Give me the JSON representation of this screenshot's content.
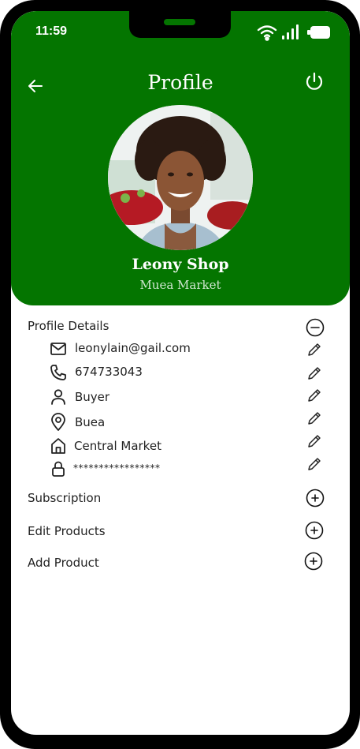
{
  "status_bar": {
    "time": "11:59"
  },
  "header": {
    "title": "Profile",
    "shop_name": "Leony Shop",
    "shop_location": "Muea Market"
  },
  "sections": {
    "profile_details": "Profile Details",
    "subscription": "Subscription",
    "edit_products": "Edit Products",
    "add_product": "Add Product"
  },
  "details": {
    "email": "leonylain@gail.com",
    "phone": "674733043",
    "role": "Buyer",
    "city": "Buea",
    "address": "Central Market",
    "password": "*****************"
  },
  "colors": {
    "brand_green": "#047500",
    "text": "#222222"
  },
  "icons": [
    "back-arrow-icon",
    "power-icon",
    "minus-circle-icon",
    "mail-icon",
    "phone-icon",
    "user-icon",
    "location-pin-icon",
    "home-icon",
    "lock-icon",
    "pencil-icon",
    "plus-circle-icon"
  ]
}
